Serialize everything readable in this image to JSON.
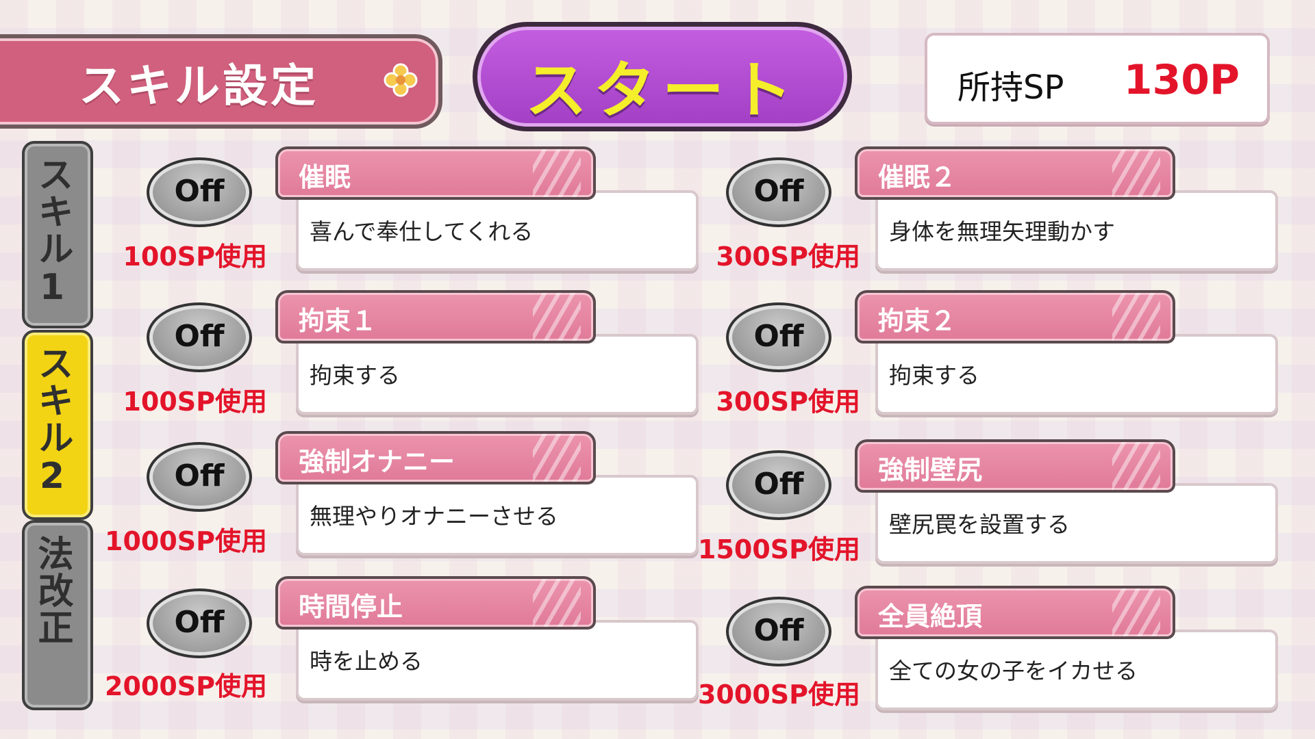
{
  "header": {
    "title": "スキル設定",
    "start_label": "スタート",
    "sp_label": "所持SP",
    "sp_value": "130P"
  },
  "tabs": [
    {
      "label": "スキル1",
      "active": false
    },
    {
      "label": "スキル2",
      "active": true
    },
    {
      "label": "法改正",
      "active": false
    }
  ],
  "skills": [
    {
      "name": "催眠",
      "desc": "喜んで奉仕してくれる",
      "cost": "100SP使用",
      "toggle": "Off"
    },
    {
      "name": "拘束１",
      "desc": "拘束する",
      "cost": "100SP使用",
      "toggle": "Off"
    },
    {
      "name": "強制オナニー",
      "desc": "無理やりオナニーさせる",
      "cost": "1000SP使用",
      "toggle": "Off"
    },
    {
      "name": "時間停止",
      "desc": "時を止める",
      "cost": "2000SP使用",
      "toggle": "Off"
    },
    {
      "name": "催眠２",
      "desc": "身体を無理矢理動かす",
      "cost": "300SP使用",
      "toggle": "Off"
    },
    {
      "name": "拘束２",
      "desc": "拘束する",
      "cost": "300SP使用",
      "toggle": "Off"
    },
    {
      "name": "強制壁尻",
      "desc": "壁尻罠を設置する",
      "cost": "1500SP使用",
      "toggle": "Off"
    },
    {
      "name": "全員絶頂",
      "desc": "全ての女の子をイカせる",
      "cost": "3000SP使用",
      "toggle": "Off"
    }
  ],
  "colors": {
    "title_bg": "#d0607d",
    "start_bg": "#b04fd3",
    "start_text": "#f5ee2a",
    "cost_red": "#e3142a",
    "tab_active": "#f2d414",
    "tab_inactive": "#8b8b8b",
    "card_tab": "#e7859f"
  },
  "icons": {
    "title_ornament": "flower-icon"
  }
}
